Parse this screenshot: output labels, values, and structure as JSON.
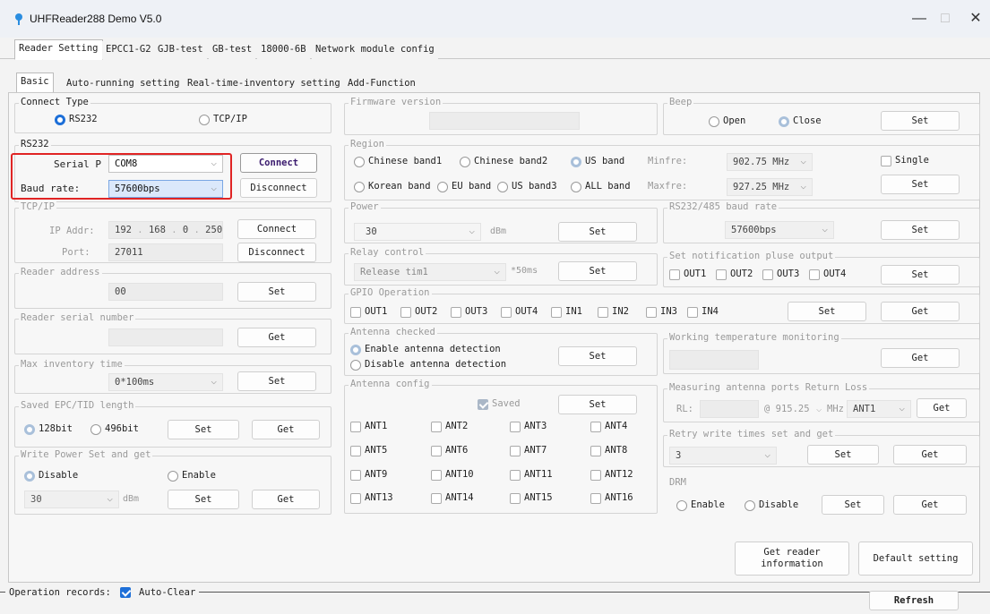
{
  "window": {
    "title": "UHFReader288 Demo V5.0",
    "min": "—",
    "max": "□",
    "close": "✕"
  },
  "main_tabs": [
    "Reader Setting",
    "EPCC1-G2",
    "GJB-test",
    "GB-test",
    "18000-6B",
    "Network module config"
  ],
  "sub_tabs": [
    "Basic",
    "Auto-running setting",
    "Real-time-inventory setting",
    "Add-Function"
  ],
  "connect_type": {
    "legend": "Connect Type",
    "rs232": "RS232",
    "tcpip": "TCP/IP"
  },
  "rs232": {
    "legend": "RS232",
    "serial_label": "Serial P",
    "serial_value": "COM8",
    "baud_label": "Baud rate:",
    "baud_value": "57600bps",
    "connect": "Connect",
    "disconnect": "Disconnect"
  },
  "tcpip": {
    "legend": "TCP/IP",
    "ip_label": "IP Addr:",
    "ip": [
      "192",
      "168",
      "0",
      "250"
    ],
    "port_label": "Port:",
    "port": "27011",
    "connect": "Connect",
    "disconnect": "Disconnect"
  },
  "reader_address": {
    "legend": "Reader address",
    "value": "00",
    "set": "Set"
  },
  "serial_number": {
    "legend": "Reader serial number",
    "get": "Get"
  },
  "max_inventory": {
    "legend": "Max inventory time",
    "value": "0*100ms",
    "set": "Set"
  },
  "epc_tid": {
    "legend": "Saved EPC/TID length",
    "opt1": "128bit",
    "opt2": "496bit",
    "set": "Set",
    "get": "Get"
  },
  "write_power": {
    "legend": "Write Power Set and get",
    "disable": "Disable",
    "enable": "Enable",
    "value": "30",
    "unit": "dBm",
    "set": "Set",
    "get": "Get"
  },
  "firmware": {
    "legend": "Firmware version"
  },
  "region": {
    "legend": "Region",
    "chinese1": "Chinese band1",
    "chinese2": "Chinese band2",
    "us": "US band",
    "korean": "Korean band",
    "eu": "EU band",
    "us3": "US band3",
    "all": "ALL band",
    "minfre_label": "Minfre:",
    "minfre": "902.75 MHz",
    "maxfre_label": "Maxfre:",
    "maxfre": "927.25 MHz",
    "single": "Single",
    "set": "Set"
  },
  "beep": {
    "legend": "Beep",
    "open": "Open",
    "close": "Close",
    "set": "Set"
  },
  "power": {
    "legend": "Power",
    "value": "30",
    "unit": "dBm",
    "set": "Set"
  },
  "baud485": {
    "legend": "RS232/485 baud rate",
    "value": "57600bps",
    "set": "Set"
  },
  "relay": {
    "legend": "Relay control",
    "value": "Release tim1",
    "unit": "*50ms",
    "set": "Set"
  },
  "notify": {
    "legend": "Set notification pluse output",
    "out1": "OUT1",
    "out2": "OUT2",
    "out3": "OUT3",
    "out4": "OUT4",
    "set": "Set"
  },
  "gpio": {
    "legend": "GPIO Operation",
    "items": [
      "OUT1",
      "OUT2",
      "OUT3",
      "OUT4",
      "IN1",
      "IN2",
      "IN3",
      "IN4"
    ],
    "set": "Set",
    "get": "Get"
  },
  "antenna_checked": {
    "legend": "Antenna checked",
    "enable": "Enable antenna detection",
    "disable": "Disable antenna detection",
    "set": "Set"
  },
  "temperature": {
    "legend": "Working temperature monitoring",
    "get": "Get"
  },
  "antenna_config": {
    "legend": "Antenna config",
    "saved": "Saved",
    "set": "Set",
    "ants": [
      "ANT1",
      "ANT2",
      "ANT3",
      "ANT4",
      "ANT5",
      "ANT6",
      "ANT7",
      "ANT8",
      "ANT9",
      "ANT10",
      "ANT11",
      "ANT12",
      "ANT13",
      "ANT14",
      "ANT15",
      "ANT16"
    ]
  },
  "return_loss": {
    "legend": "Measuring antenna ports Return Loss",
    "rl_label": "RL:",
    "freq": "@ 915.25",
    "unit": "MHz",
    "ant": "ANT1",
    "get": "Get"
  },
  "retry": {
    "legend": "Retry write times set and get",
    "value": "3",
    "set": "Set",
    "get": "Get"
  },
  "drm": {
    "legend": "DRM",
    "enable": "Enable",
    "disable": "Disable",
    "set": "Set",
    "get": "Get"
  },
  "bottom": {
    "get_info": "Get reader information",
    "default": "Default setting",
    "records": "Operation records:",
    "auto_clear": "Auto-Clear",
    "refresh": "Refresh"
  }
}
